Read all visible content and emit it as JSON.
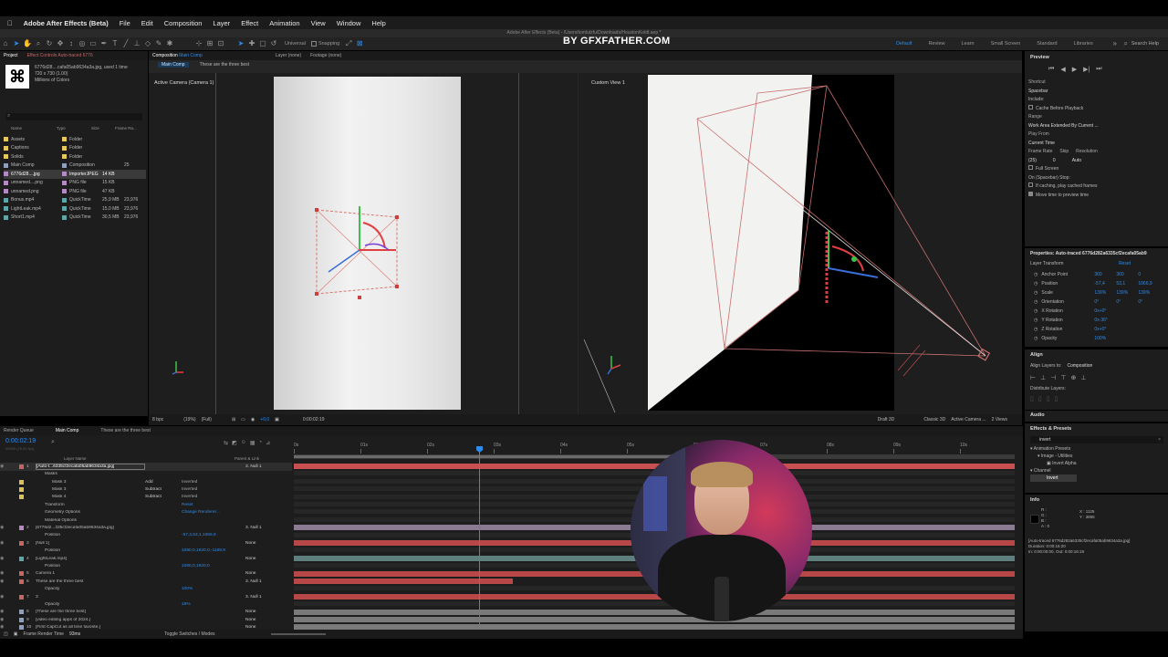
{
  "menubar": {
    "apple": "",
    "app": "Adobe After Effects (Beta)",
    "items": [
      "File",
      "Edit",
      "Composition",
      "Layer",
      "Effect",
      "Animation",
      "View",
      "Window",
      "Help"
    ]
  },
  "window_title": "Adobe After Effects (Beta) - /Users/tomlutzfu/Downloads/HoustonKoldt.aep *",
  "watermark": "BY GFXFATHER.COM",
  "toolbar": {
    "universal": "Universal",
    "snapping": "Snapping",
    "workspaces": [
      "Default",
      "Review",
      "Learn",
      "Small Screen",
      "Standard",
      "Libraries"
    ],
    "active_workspace": "Default",
    "search_help": "Search Help"
  },
  "project": {
    "tabs": [
      "Project",
      "Effect Controls Auto-traced 6776"
    ],
    "selected_name": "6776d28....cafa05ab9634a3a.jpg",
    "selected_used": ", used 1 time",
    "selected_dims": "720 x 730 (1.00)",
    "selected_colors": "Millions of Colors",
    "columns": [
      "Name",
      "Type",
      "Size",
      "Frame Ra..."
    ],
    "items": [
      {
        "name": "Assets",
        "type": "Folder",
        "size": "",
        "fps": "",
        "color": "#e8c85a"
      },
      {
        "name": "Captions",
        "type": "Folder",
        "size": "",
        "fps": "",
        "color": "#e8c85a"
      },
      {
        "name": "Solids",
        "type": "Folder",
        "size": "",
        "fps": "",
        "color": "#e8c85a"
      },
      {
        "name": "Main Comp",
        "type": "Composition",
        "size": "",
        "fps": "25",
        "color": "#8fa0bf"
      },
      {
        "name": "6776d28....jpg",
        "type": "ImporterJPEG",
        "size": "14 KB",
        "fps": "",
        "color": "#b58ac2"
      },
      {
        "name": "unnamed....png",
        "type": "PNG file",
        "size": "15 KB",
        "fps": "",
        "color": "#b58ac2"
      },
      {
        "name": "unnamed.png",
        "type": "PNG file",
        "size": "47 KB",
        "fps": "",
        "color": "#b58ac2"
      },
      {
        "name": "Bonus.mp4",
        "type": "QuickTime",
        "size": "25,9 MB",
        "fps": "23,976",
        "color": "#5fa6a6"
      },
      {
        "name": "LightLeak.mp4",
        "type": "QuickTime",
        "size": "15,0 MB",
        "fps": "23,976",
        "color": "#5fa6a6"
      },
      {
        "name": "Short1.mp4",
        "type": "QuickTime",
        "size": "30,5 MB",
        "fps": "23,976",
        "color": "#5fa6a6"
      }
    ]
  },
  "composition": {
    "tab": "Composition",
    "tab_name": "Main Comp",
    "breadcrumb": [
      "Main Comp",
      "These are the three best"
    ],
    "layer_tab": "Layer (none)",
    "footage_tab": "Footage (none)",
    "view_left": "Active Camera (Camera 1)",
    "view_right": "Custom View 1",
    "zoom": "(19%)",
    "quality": "(Full)",
    "timecode": "0:00:02:19",
    "renderer": "Draft 3D",
    "renderer2": "Classic 3D",
    "camera": "Active Camera ...",
    "views": "2 Views",
    "bits": "8 bpc",
    "exposure": "+0,0"
  },
  "preview": {
    "title": "Preview",
    "shortcut_label": "Shortcut",
    "shortcut": "Spacebar",
    "include": "Include:",
    "cache": "Cache Before Playback",
    "range_label": "Range",
    "range": "Work Area Extended By Current ...",
    "play_from_label": "Play From",
    "play_from": "Current Time",
    "frame_rate_label": "Frame Rate",
    "skip_label": "Skip",
    "resolution_label": "Resolution",
    "frame_rate": "(25)",
    "skip": "0",
    "resolution": "Auto",
    "full_screen": "Full Screen",
    "on_stop": "On (Spacebar) Stop:",
    "if_caching": "If caching, play cached frames",
    "move_time": "Move time to preview time"
  },
  "properties": {
    "title": "Properties: Auto-traced 6776d282a6335cf2ecafa05ab9",
    "section": "Layer Transform",
    "reset": "Reset",
    "rows": [
      {
        "label": "Anchor Point",
        "v1": "360",
        "v2": "360",
        "v3": "0"
      },
      {
        "label": "Position",
        "v1": "-57,4",
        "v2": "53,1",
        "v3": "1066,9"
      },
      {
        "label": "Scale",
        "v1": "139%",
        "v2": "139%",
        "v3": "139%"
      },
      {
        "label": "Orientation",
        "v1": "0°",
        "v2": "0°",
        "v3": "0°"
      },
      {
        "label": "X Rotation",
        "v1": "0x+0°",
        "v2": "",
        "v3": ""
      },
      {
        "label": "Y Rotation",
        "v1": "0x-36°",
        "v2": "",
        "v3": ""
      },
      {
        "label": "Z Rotation",
        "v1": "0x+0°",
        "v2": "",
        "v3": ""
      },
      {
        "label": "Opacity",
        "v1": "100%",
        "v2": "",
        "v3": ""
      }
    ]
  },
  "align": {
    "title": "Align",
    "align_to_label": "Align Layers to:",
    "align_to": "Composition",
    "distribute": "Distribute Layers:"
  },
  "audio": {
    "title": "Audio"
  },
  "effects": {
    "title": "Effects & Presets",
    "search": "invert",
    "tree": [
      "Animation Presets",
      "Image - Utilities",
      "Invert Alpha",
      "Channel",
      "Invert"
    ]
  },
  "info": {
    "title": "Info",
    "x": "X : 1125",
    "y": "Y : 3855",
    "r": "R :",
    "g": "G :",
    "b": "B :",
    "a": "A : 0",
    "file": "[Auto-traced 6776d282a6335cf2ecafa05ab9634a3a.jpg]",
    "duration": "Duration: 0:00:16:20",
    "inout": "In: 0:00:00:00, Out: 0:00:16:19"
  },
  "timeline": {
    "tabs": [
      "Render Queue",
      "Main Comp",
      "These are the three best"
    ],
    "timecode": "0:00:02:19",
    "fps_note": "00069 (25,00 fps)",
    "layer_name_header": "Layer Name",
    "parent_header": "Parent & Link",
    "ruler": [
      "0s",
      "01s",
      "02s",
      "03s",
      "04s",
      "05s",
      "06s",
      "07s",
      "08s",
      "09s",
      "10s"
    ],
    "footer_left": "Frame Render Time",
    "frame_time": "93ms",
    "toggle": "Toggle Switches / Modes",
    "layers": [
      {
        "num": "1",
        "name": "[Auto-t...6335cf2ecafa05ab9634a3a.jpg]",
        "color": "#c86464",
        "parent": "3. Null 1",
        "kind": "layer",
        "selected": true
      },
      {
        "num": "",
        "name": "Masks",
        "color": "",
        "parent": "",
        "kind": "group"
      },
      {
        "num": "",
        "name": "Mask 3",
        "color": "#d8c05a",
        "parent": "",
        "mode": "Add",
        "extra": "Inverted",
        "kind": "mask"
      },
      {
        "num": "",
        "name": "Mask 3",
        "color": "#d8c05a",
        "parent": "",
        "mode": "Subtract",
        "extra": "Inverted",
        "kind": "mask"
      },
      {
        "num": "",
        "name": "Mask 4",
        "color": "#d8c05a",
        "parent": "",
        "mode": "Subtract",
        "extra": "Inverted",
        "kind": "mask"
      },
      {
        "num": "",
        "name": "Transform",
        "color": "",
        "parent": "",
        "extra": "Reset",
        "kind": "group"
      },
      {
        "num": "",
        "name": "Geometry Options",
        "color": "",
        "parent": "",
        "extra": "Change Renderer...",
        "kind": "group"
      },
      {
        "num": "",
        "name": "Material Options",
        "color": "",
        "parent": "",
        "kind": "group"
      },
      {
        "num": "2",
        "name": "[6776d2...335cf2ecafa05ab9634a3a.jpg]",
        "color": "#b58ac2",
        "parent": "3. Null 1",
        "kind": "layer"
      },
      {
        "num": "",
        "name": "Position",
        "color": "",
        "parent": "",
        "extra": "-57,4,53,1,1066,9",
        "kind": "prop"
      },
      {
        "num": "3",
        "name": "[Null 1]",
        "color": "#c86464",
        "parent": "None",
        "kind": "layer"
      },
      {
        "num": "",
        "name": "Position",
        "color": "",
        "parent": "",
        "extra": "1080,0,1920,0,-1169,9",
        "kind": "prop"
      },
      {
        "num": "4",
        "name": "[LightLeak.mp4]",
        "color": "#5fa6a6",
        "parent": "None",
        "kind": "layer"
      },
      {
        "num": "",
        "name": "Position",
        "color": "",
        "parent": "",
        "extra": "1080,0,1920,0",
        "kind": "prop"
      },
      {
        "num": "5",
        "name": "Camera 1",
        "color": "#c86464",
        "parent": "None",
        "kind": "layer"
      },
      {
        "num": "6",
        "name": "These are the three best",
        "color": "#c86464",
        "parent": "3. Null 1",
        "kind": "layer"
      },
      {
        "num": "",
        "name": "Opacity",
        "color": "",
        "parent": "",
        "extra": "100%",
        "kind": "prop"
      },
      {
        "num": "7",
        "name": "3",
        "color": "#c86464",
        "parent": "3. Null 1",
        "kind": "layer"
      },
      {
        "num": "",
        "name": "Opacity",
        "color": "",
        "parent": "",
        "extra": "19%",
        "kind": "prop"
      },
      {
        "num": "8",
        "name": "[These are the three best]",
        "color": "#8fa0bf",
        "parent": "None",
        "kind": "layer"
      },
      {
        "num": "9",
        "name": "[video editing apps of 2024.]",
        "color": "#8fa0bf",
        "parent": "None",
        "kind": "layer"
      },
      {
        "num": "10",
        "name": "[First CapCut as all time favorite.]",
        "color": "#8fa0bf",
        "parent": "None",
        "kind": "layer"
      }
    ]
  },
  "colors": {
    "accent": "#2d8ceb",
    "panel": "#1d1d1d",
    "track_red": "#b84848",
    "track_gray": "#7a7a7a"
  }
}
